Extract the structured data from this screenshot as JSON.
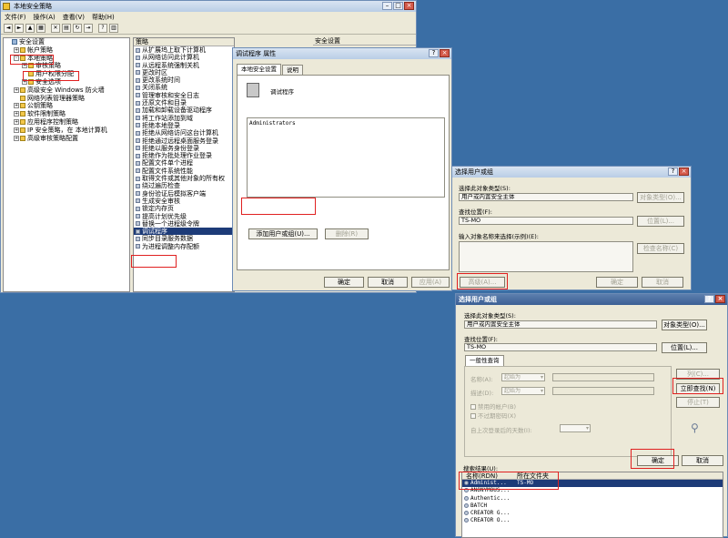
{
  "main_window": {
    "title": "本地安全策略",
    "menu": [
      "文件(F)",
      "操作(A)",
      "查看(V)",
      "帮助(H)"
    ],
    "tree": [
      {
        "label": "安全设置",
        "level": 0,
        "exp": ""
      },
      {
        "label": "帐户策略",
        "level": 1,
        "exp": "+"
      },
      {
        "label": "本地策略",
        "level": 1,
        "exp": "-"
      },
      {
        "label": "审核策略",
        "level": 2,
        "exp": "+"
      },
      {
        "label": "用户权限分配",
        "level": 2,
        "exp": "",
        "highlight": true
      },
      {
        "label": "安全选项",
        "level": 2,
        "exp": "+"
      },
      {
        "label": "高级安全 Windows 防火墙",
        "level": 1,
        "exp": "+"
      },
      {
        "label": "网络列表管理器策略",
        "level": 1,
        "exp": ""
      },
      {
        "label": "公钥策略",
        "level": 1,
        "exp": "+"
      },
      {
        "label": "软件限制策略",
        "level": 1,
        "exp": "+"
      },
      {
        "label": "应用程序控制策略",
        "level": 1,
        "exp": "+"
      },
      {
        "label": "IP 安全策略，在 本地计算机",
        "level": 1,
        "exp": "+"
      },
      {
        "label": "高级审核策略配置",
        "level": 1,
        "exp": "+"
      }
    ],
    "list_headers": [
      "策略",
      "安全设置"
    ],
    "list_items": [
      "从扩展坞上取下计算机",
      "从网络访问此计算机",
      "从远程系统强制关机",
      "更改时区",
      "更改系统时间",
      "关闭系统",
      "管理审核和安全日志",
      "还原文件和目录",
      "加载和卸载设备驱动程序",
      "将工作站添加到域",
      "拒绝本地登录",
      "拒绝从网络访问这台计算机",
      "拒绝通过远程桌面服务登录",
      "拒绝以服务身份登录",
      "拒绝作为批处理作业登录",
      "配置文件单个进程",
      "配置文件系统性能",
      "取得文件或其他对象的所有权",
      "绕过遍历检查",
      "身份验证后模拟客户端",
      "生成安全审核",
      "锁定内存页",
      "提高计划优先级",
      "替换一个进程级令牌",
      "调试程序",
      "同步目录服务数据",
      "为进程调整内存配额"
    ],
    "selected_item": "调试程序"
  },
  "props_dialog": {
    "title": "调试程序 属性",
    "tabs": [
      "本地安全设置",
      "说明"
    ],
    "policy_name": "调试程序",
    "members": [
      "Administrators"
    ],
    "add_button": "添加用户或组(U)...",
    "remove_button": "删除(R)",
    "ok": "确定",
    "cancel": "取消",
    "apply": "应用(A)"
  },
  "select_dialog_1": {
    "title": "选择用户或组",
    "object_type_label": "选择此对象类型(S):",
    "object_type_value": "用户或内置安全主体",
    "object_type_button": "对象类型(O)...",
    "location_label": "查找位置(F):",
    "location_value": "TS-MO",
    "location_button": "位置(L)...",
    "names_label": "输入对象名称来选择(示例)(E):",
    "check_names_button": "检查名称(C)",
    "advanced_button": "高级(A)...",
    "ok": "确定",
    "cancel": "取消"
  },
  "select_dialog_2": {
    "title": "选择用户或组",
    "object_type_label": "选择此对象类型(S):",
    "object_type_value": "用户或内置安全主体",
    "object_type_button": "对象类型(O)...",
    "location_label": "查找位置(F):",
    "location_value": "TS-MO",
    "location_button": "位置(L)...",
    "tab": "一般性查询",
    "name_label": "名称(A):",
    "desc_label": "描述(D):",
    "starts_with": "起始为",
    "columns_button": "列(C)...",
    "find_now_button": "立即查找(N)",
    "stop_button": "停止(T)",
    "disabled_accounts": "禁用的帐户(B)",
    "non_expiring": "不过期密码(X)",
    "days_since_logon": "自上次登录后的天数(I):",
    "results_label": "搜索结果(U):",
    "ok": "确定",
    "cancel": "取消",
    "result_headers": [
      "名称(RDN)",
      "所在文件夹"
    ],
    "results": [
      {
        "name": "Administ...",
        "folder": "TS-MO",
        "selected": true
      },
      {
        "name": "ANONYMOUS...",
        "folder": ""
      },
      {
        "name": "Authentic...",
        "folder": ""
      },
      {
        "name": "BATCH",
        "folder": ""
      },
      {
        "name": "CREATOR G...",
        "folder": ""
      },
      {
        "name": "CREATOR O...",
        "folder": ""
      }
    ]
  }
}
